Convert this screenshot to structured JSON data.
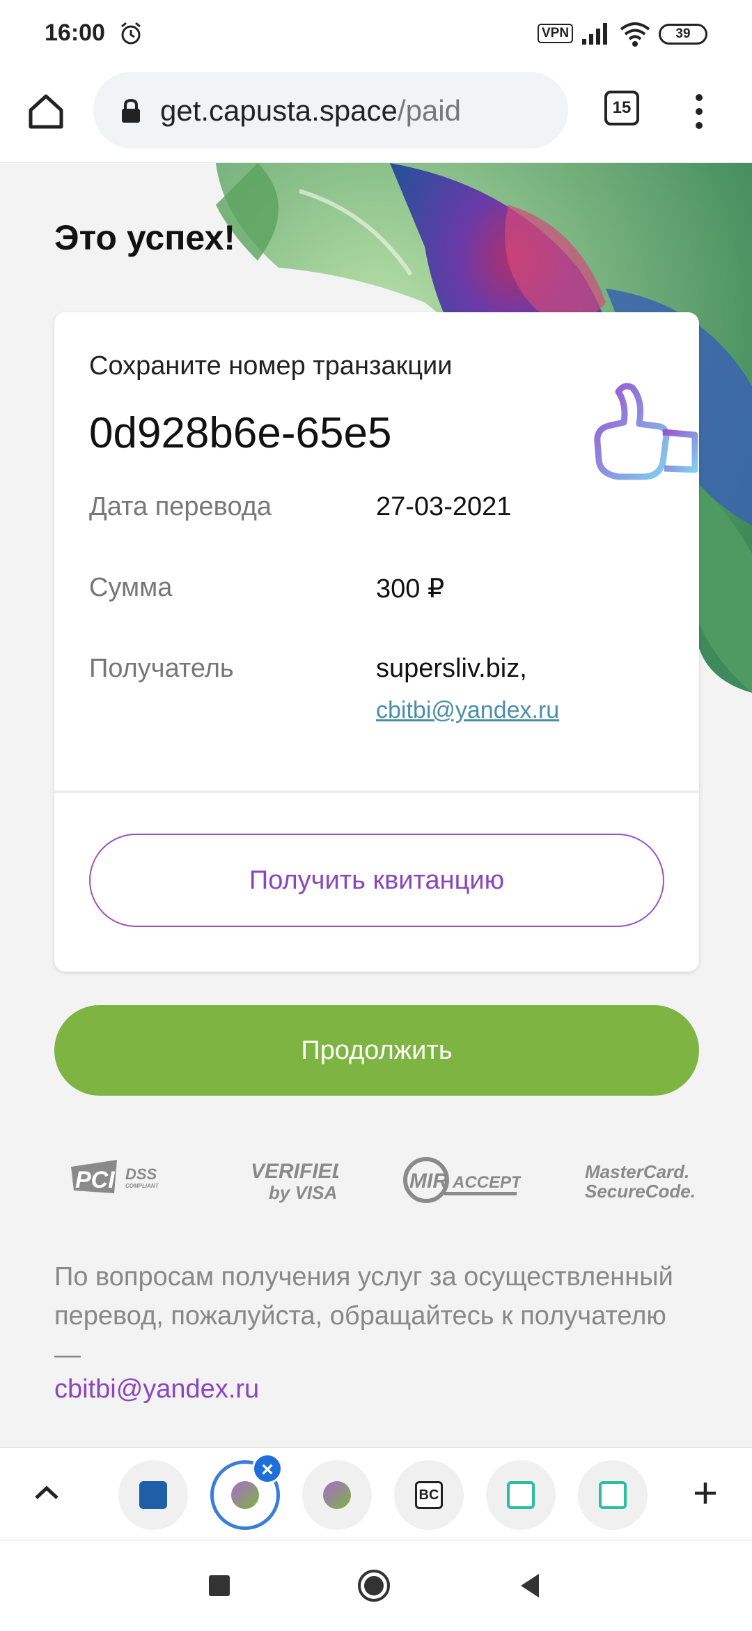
{
  "status_bar": {
    "time": "16:00",
    "vpn": "VPN",
    "battery": "39",
    "icons": [
      "alarm-icon",
      "signal-icon",
      "wifi-icon",
      "battery-icon"
    ]
  },
  "browser": {
    "url_host": "get.capusta.space",
    "url_path": "/paid",
    "tab_count": "15"
  },
  "page": {
    "title": "Это успех!",
    "save_label": "Сохраните номер транзакции",
    "transaction_id": "0d928b6e-65e5",
    "rows": [
      {
        "label": "Дата перевода",
        "value": "27-03-2021"
      },
      {
        "label": "Сумма",
        "value": "300 ₽"
      },
      {
        "label": "Получатель",
        "value": "supersliv.biz,",
        "link": "cbitbi@yandex.ru"
      }
    ],
    "receipt_button": "Получить квитанцию",
    "continue_button": "Продолжить",
    "logos": {
      "pci": "PCI",
      "pci_dss": "DSS",
      "pci_compliant": "COMPLIANT",
      "visa_line1": "VERIFIED",
      "visa_line2": "by VISA",
      "mir": "MIR",
      "mir_accept": "ACCEPT",
      "mc_line1": "MasterCard.",
      "mc_line2": "SecureCode."
    },
    "footer_text": "По вопросам получения услуг за осуществленный перевод, пожалуйста, обращайтесь к получателю —",
    "footer_email": "cbitbi@yandex.ru"
  },
  "tabstrip": {
    "tab_favicon_label": "BC"
  },
  "colors": {
    "accent_purple": "#8a45c0",
    "continue_green": "#7db442",
    "link_teal": "#4a8fa8",
    "active_tab_blue": "#3b7ddd"
  }
}
